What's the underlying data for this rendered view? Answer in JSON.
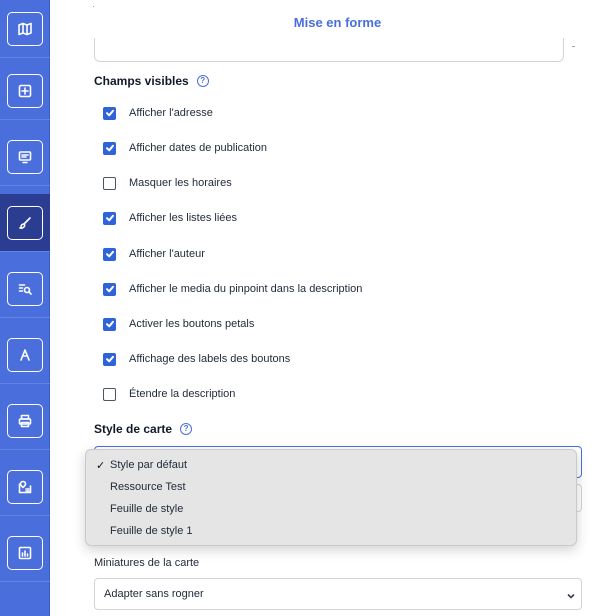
{
  "sidebar": {
    "items": [
      {
        "icon": "map-icon",
        "active": false
      },
      {
        "icon": "map-link-icon",
        "active": false
      },
      {
        "icon": "screen-icon",
        "active": false
      },
      {
        "icon": "brush-icon",
        "active": true
      },
      {
        "icon": "search-list-icon",
        "active": false
      },
      {
        "icon": "font-icon",
        "active": false
      },
      {
        "icon": "printer-icon",
        "active": false
      },
      {
        "icon": "map-pin-icon",
        "active": false
      },
      {
        "icon": "chart-icon",
        "active": false
      }
    ]
  },
  "panel": {
    "title": "Mise en forme"
  },
  "visible_fields": {
    "label": "Champs visibles",
    "help": "?",
    "options": [
      {
        "label": "Afficher l'adresse",
        "checked": true
      },
      {
        "label": "Afficher dates de publication",
        "checked": true
      },
      {
        "label": "Masquer les horaires",
        "checked": false
      },
      {
        "label": "Afficher les listes liées",
        "checked": true
      },
      {
        "label": "Afficher l'auteur",
        "checked": true
      },
      {
        "label": "Afficher le media du pinpoint dans la description",
        "checked": true
      },
      {
        "label": "Activer les boutons petals",
        "checked": true
      },
      {
        "label": "Affichage des labels des boutons",
        "checked": true
      },
      {
        "label": "Étendre la description",
        "checked": false
      }
    ]
  },
  "map_style": {
    "label": "Style de carte",
    "help": "?",
    "check_glyph": "✓",
    "options": [
      "Style par défaut",
      "Ressource Test",
      "Feuille de style",
      "Feuille de style 1"
    ],
    "selected": "Style par défaut"
  },
  "thumbnails": {
    "label": "Miniatures de la carte",
    "value": "Adapter sans rogner"
  }
}
